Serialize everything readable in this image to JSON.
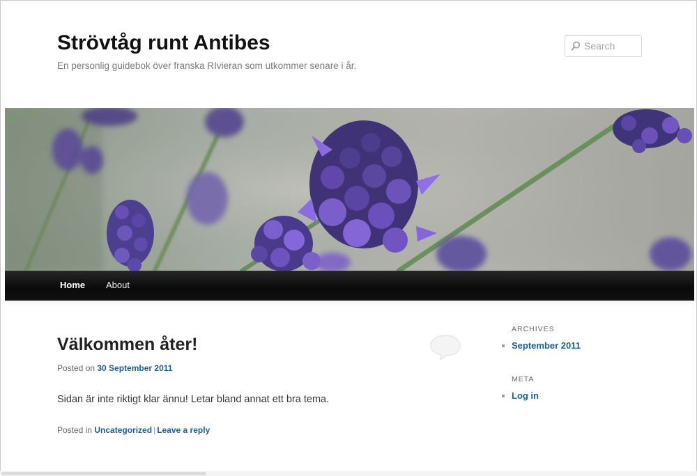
{
  "site": {
    "title": "Strövtåg runt Antibes",
    "description": "En personlig guidebok över franska RIvieran som utkommer senare i år."
  },
  "search": {
    "placeholder": "Search",
    "icon": "search-icon"
  },
  "header_image": {
    "subject": "lavender flowers"
  },
  "nav": {
    "items": [
      {
        "label": "Home",
        "active": true
      },
      {
        "label": "About",
        "active": false
      }
    ]
  },
  "post": {
    "title": "Välkommen åter!",
    "posted_on_prefix": "Posted on",
    "date": "30 September 2011",
    "content": "Sidan är inte riktigt klar ännu! Letar bland annat ett bra tema.",
    "posted_in_prefix": "Posted in",
    "category": "Uncategorized",
    "separator": "|",
    "reply_label": "Leave a reply",
    "comment_icon": "comment-bubble-icon"
  },
  "sidebar": {
    "archives": {
      "title": "ARCHIVES",
      "items": [
        "September 2011"
      ]
    },
    "meta": {
      "title": "META",
      "items": [
        "Log in"
      ]
    }
  },
  "colors": {
    "link": "#1b5f95",
    "nav_background": "#111111",
    "title": "#111111"
  }
}
